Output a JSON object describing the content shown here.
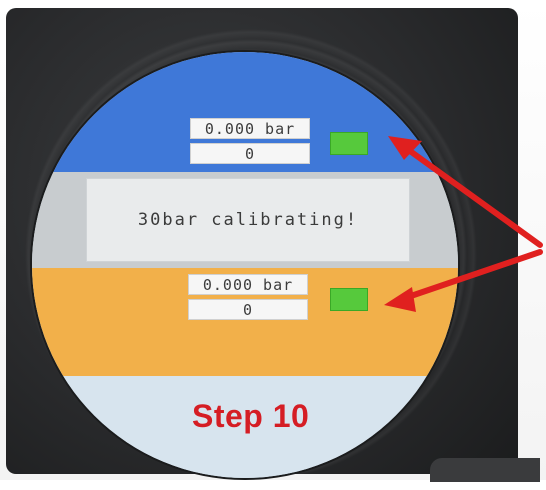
{
  "top_readout": {
    "pressure": "0.000 bar",
    "count": "0"
  },
  "bottom_readout": {
    "pressure": "0.000 bar",
    "count": "0"
  },
  "status_message": "30bar calibrating!",
  "caption": "Step 10",
  "colors": {
    "top_band": "#3f78d8",
    "bottom_band": "#f2b04a",
    "indicator": "#56c93c",
    "caption": "#d51d24",
    "arrow": "#e0201f"
  },
  "icons": {
    "indicator_top": "green-status-light",
    "indicator_bottom": "green-status-light",
    "arrows": "annotation-arrow"
  }
}
